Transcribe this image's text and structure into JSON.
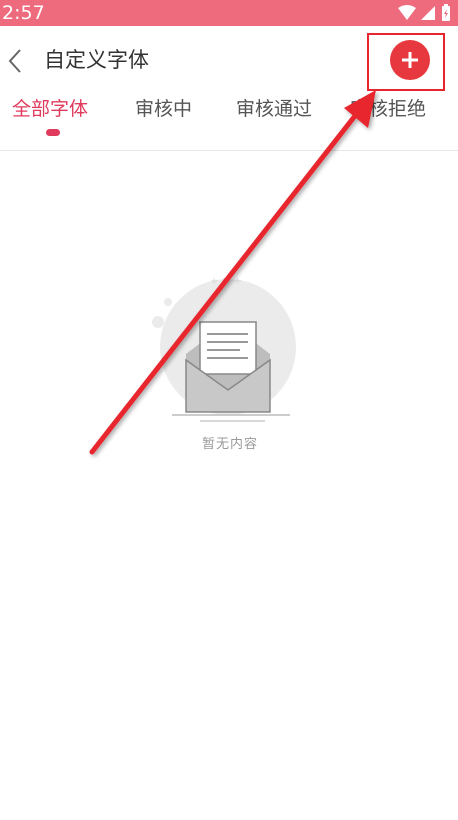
{
  "status": {
    "time": "2:57"
  },
  "header": {
    "title": "自定义字体",
    "back_icon": "chevron-left-icon",
    "add_icon": "plus-icon"
  },
  "tabs": [
    {
      "label": "全部字体",
      "active": true
    },
    {
      "label": "审核中",
      "active": false
    },
    {
      "label": "审核通过",
      "active": false
    },
    {
      "label": "审核拒绝",
      "active": false
    }
  ],
  "empty_state": {
    "text": "暂无内容",
    "icon": "empty-envelope-icon"
  },
  "colors": {
    "status_bar": "#ee6b7e",
    "accent": "#e03a5c",
    "add_button": "#e6383e",
    "annotation": "#e8252e"
  }
}
